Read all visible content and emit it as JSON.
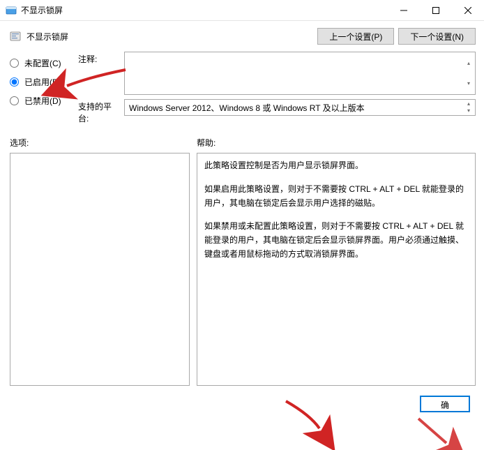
{
  "window": {
    "title": "不显示锁屏",
    "policy_title": "不显示锁屏"
  },
  "nav": {
    "prev": "上一个设置(P)",
    "next": "下一个设置(N)"
  },
  "radios": {
    "not_configured": "未配置(C)",
    "enabled": "已启用(E)",
    "disabled": "已禁用(D)"
  },
  "labels": {
    "comment": "注释:",
    "supported": "支持的平台:",
    "options": "选项:",
    "help": "帮助:"
  },
  "fields": {
    "comment_value": "",
    "supported_value": "Windows Server 2012、Windows 8 或 Windows RT 及以上版本"
  },
  "help": {
    "p1": "此策略设置控制是否为用户显示锁屏界面。",
    "p2": "如果启用此策略设置，则对于不需要按 CTRL + ALT + DEL  就能登录的用户，其电脑在锁定后会显示用户选择的磁贴。",
    "p3": "如果禁用或未配置此策略设置，则对于不需要按 CTRL + ALT + DEL 就能登录的用户，其电脑在锁定后会显示锁屏界面。用户必须通过触摸、键盘或者用鼠标拖动的方式取消锁屏界面。"
  },
  "buttons": {
    "ok": "确"
  }
}
